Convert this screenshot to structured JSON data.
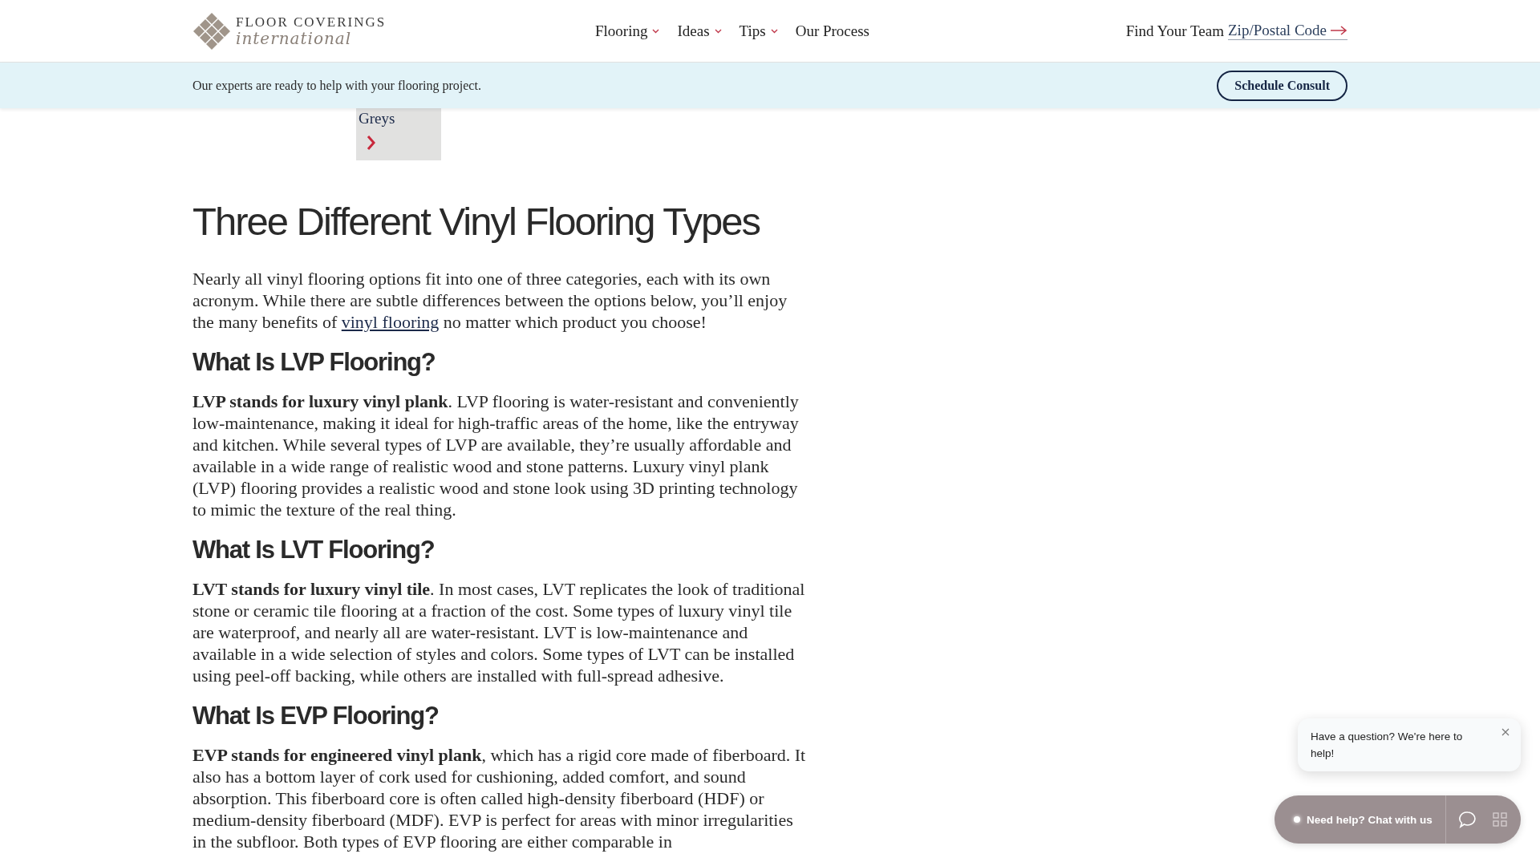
{
  "header": {
    "logo": {
      "name": "FLOOR COVERINGS",
      "tagline": "international"
    },
    "nav": [
      {
        "label": "Flooring",
        "has_menu": true
      },
      {
        "label": "Ideas",
        "has_menu": true
      },
      {
        "label": "Tips",
        "has_menu": true
      },
      {
        "label": "Our Process",
        "has_menu": false
      }
    ],
    "find_team": {
      "label": "Find Your Team",
      "link": "Zip/Postal Code"
    }
  },
  "banner": {
    "text": "Our experts are ready to help with your flooring project.",
    "button": "Schedule Consult"
  },
  "tile": {
    "label": "Greys"
  },
  "article": {
    "title": "Three Different Vinyl Flooring Types",
    "intro": {
      "before": "Nearly all vinyl flooring options fit into one of three categories, each with its own acronym. While there are subtle differences between the options below, you’ll enjoy the many benefits of",
      "link": "vinyl flooring",
      "after": "no matter which product you choose!"
    },
    "sections": [
      {
        "heading": "What Is LVP Flooring?",
        "paragraph": "**LVP stands for luxury vinyl plank**. LVP flooring is water-resistant and conveniently low-maintenance, making it ideal for high-traffic areas of the home, like the entryway and kitchen. While several types of LVP are available, they’re usually affordable and available in a wide range of realistic wood and stone patterns. Luxury vinyl plank (LVP) flooring provides a realistic wood and stone look using 3D printing technology to mimic the texture of the real thing."
      },
      {
        "heading": "What Is LVT Flooring?",
        "paragraph": "**LVT stands for luxury vinyl tile**. In most cases, LVT replicates the look of traditional stone or ceramic tile flooring at a fraction of the cost. Some types of luxury vinyl tile are waterproof, and nearly all are water-resistant. LVT is low-maintenance and available in a wide selection of styles and colors. Some types of LVT can be installed using peel-off backing, while others are installed with full-spread adhesive."
      },
      {
        "heading": "What Is EVP Flooring?",
        "paragraph": "**EVP stands for engineered vinyl plank**, which has a rigid core made of fiberboard. It also has a bottom layer of cork used for cushioning, added comfort, and sound absorption. This fiberboard core is often called high-density fiberboard (HDF) or medium-density fiberboard (MDF). EVP is perfect for areas with minor irregularities in the subfloor. Both types of EVP flooring are either comparable in"
      }
    ]
  },
  "chat": {
    "bubble": "Have a question? We're here to help!",
    "button": "Need help? Chat with us"
  }
}
